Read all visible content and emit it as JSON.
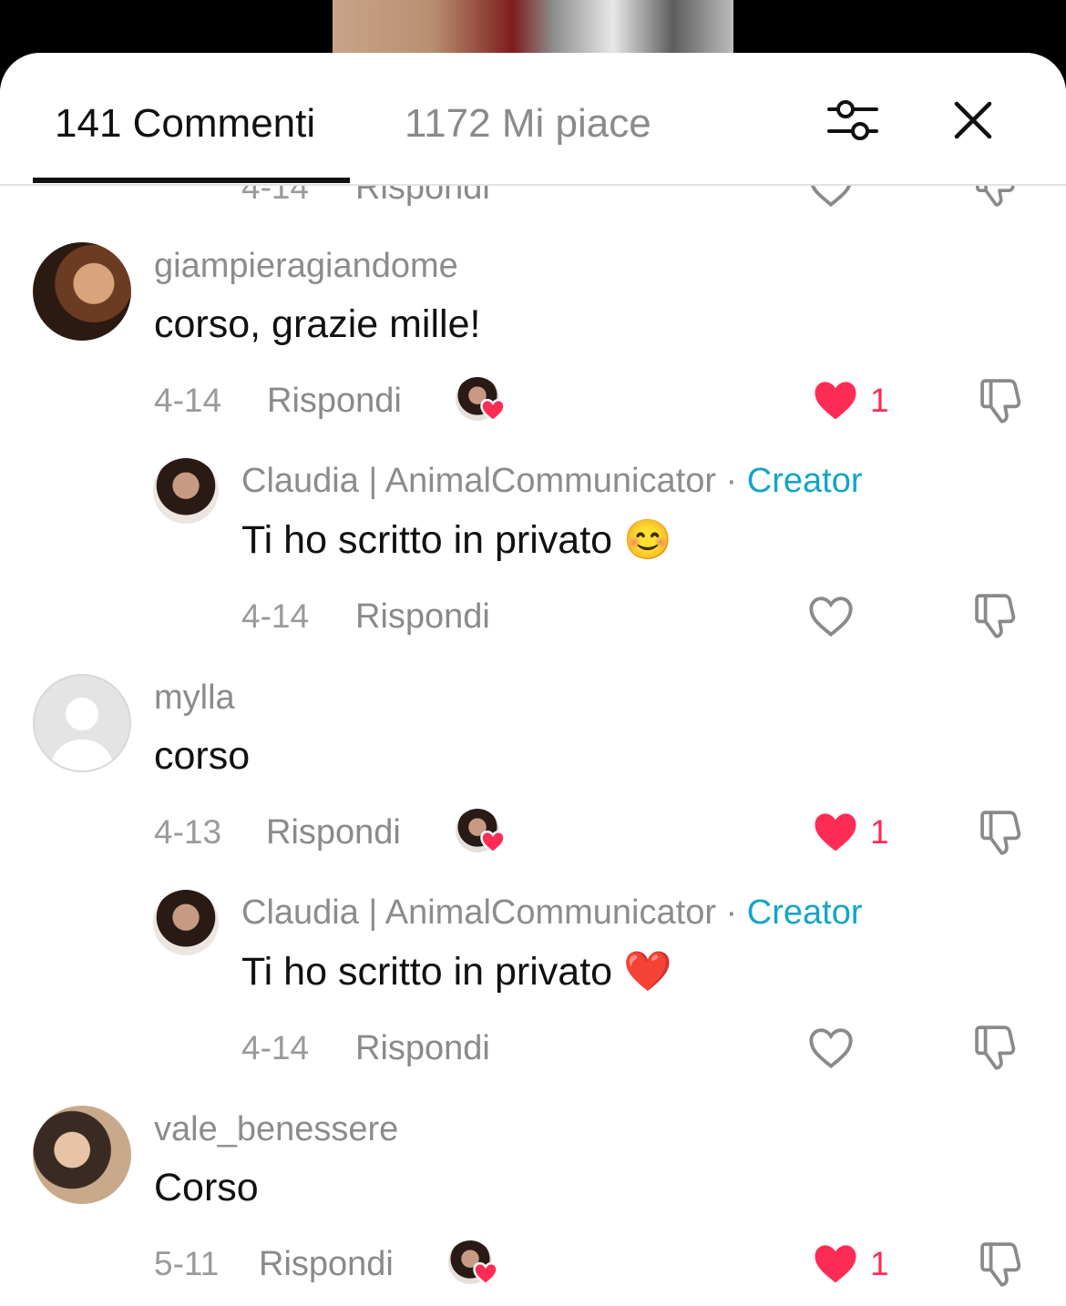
{
  "header": {
    "comments_tab": "141 Commenti",
    "likes_tab": "1172 Mi piace"
  },
  "partial_row": {
    "date": "4-14",
    "reply": "Rispondi"
  },
  "comments": [
    {
      "username": "giampieragiandome",
      "text": "corso, grazie mille!",
      "date": "4-14",
      "reply": "Rispondi",
      "likes": "1",
      "creator_liked": true,
      "reply_item": {
        "username": "Claudia | AnimalCommunicator",
        "separator": "·",
        "badge": "Creator",
        "text": "Ti ho scritto in privato 😊",
        "date": "4-14",
        "reply": "Rispondi"
      }
    },
    {
      "username": "mylla",
      "text": "corso",
      "date": "4-13",
      "reply": "Rispondi",
      "likes": "1",
      "creator_liked": true,
      "reply_item": {
        "username": "Claudia | AnimalCommunicator",
        "separator": "·",
        "badge": "Creator",
        "text": "Ti ho scritto in privato ❤️",
        "date": "4-14",
        "reply": "Rispondi"
      }
    },
    {
      "username": "vale_benessere",
      "text": "Corso",
      "date": "5-11",
      "reply": "Rispondi",
      "likes": "1",
      "creator_liked": true
    }
  ],
  "colors": {
    "accent_like": "#fe2c55",
    "creator_badge": "#13a5c8",
    "secondary_text": "#8a8a8a"
  },
  "icons": [
    "sliders-filter-icon",
    "close-icon",
    "heart-icon",
    "heart-filled-icon",
    "dislike-icon"
  ]
}
